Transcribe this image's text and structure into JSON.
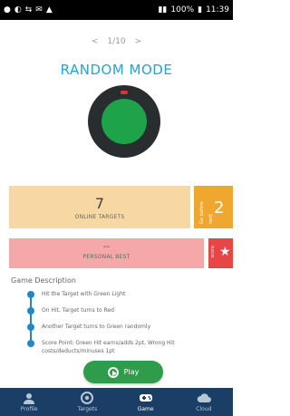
{
  "statusbar": {
    "time": "11:39",
    "battery": "100%"
  },
  "pager": {
    "prev": "<",
    "text": "1/10",
    "next": ">"
  },
  "title": "RANDOM MODE",
  "online": {
    "value": "7",
    "label": "ONLINE TARGETS",
    "side_label": "Go before next",
    "side_value": "2"
  },
  "personal": {
    "value": "--",
    "label": "PERSONAL BEST",
    "side_label": "score"
  },
  "description": {
    "title": "Game Description",
    "items": [
      "Hit the Target with Green Light",
      "On Hit, Target turns to Red",
      "Another Target turns to Green randomly",
      "Score Point: Green Hit earns/adds 2pt, Wrong Hit costs/deducts/minuses 1pt"
    ]
  },
  "play": {
    "label": "Play"
  },
  "nav": {
    "items": [
      {
        "label": "Profile",
        "icon": "person-icon"
      },
      {
        "label": "Targets",
        "icon": "target-icon"
      },
      {
        "label": "Game",
        "icon": "gamepad-icon"
      },
      {
        "label": "Cloud",
        "icon": "cloud-icon"
      }
    ],
    "active_index": 2
  },
  "colors": {
    "accent": "#24a3d4",
    "yellow_card": "#f7d7a2",
    "orange": "#f0a72f",
    "pink_card": "#f6a8a8",
    "red": "#e64646",
    "play_green": "#2e9c4a",
    "nav_bg": "#1b3e66",
    "target_green": "#1fa34a"
  }
}
